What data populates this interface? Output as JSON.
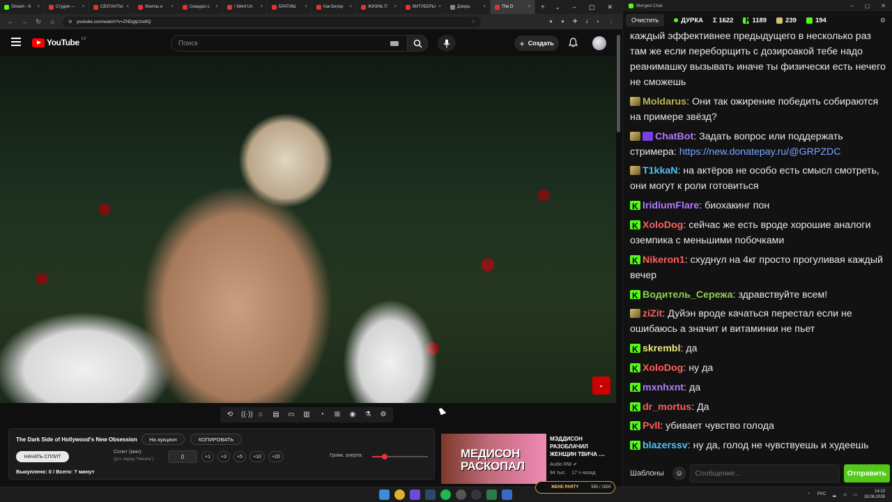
{
  "browser": {
    "tabs": [
      {
        "label": "Stream - K",
        "icon": "kick"
      },
      {
        "label": "Студия —",
        "icon": "youtube"
      },
      {
        "label": "СЕКТАНТЫ",
        "icon": "youtube"
      },
      {
        "label": "Жиллы и",
        "icon": "youtube"
      },
      {
        "label": "Скандал с",
        "icon": "youtube"
      },
      {
        "label": "I Went Un",
        "icon": "youtube"
      },
      {
        "label": "БРАТИШ",
        "icon": "youtube"
      },
      {
        "label": "Как Белор",
        "icon": "youtube"
      },
      {
        "label": "ЖИЗНЬ П",
        "icon": "youtube"
      },
      {
        "label": "ВИТУБЕРЫ",
        "icon": "youtube"
      },
      {
        "label": "Дзюра",
        "icon": "dark"
      },
      {
        "label": "The D",
        "icon": "youtube"
      }
    ],
    "url": "youtube.com/watch?v=ZNDgljz2w9Q"
  },
  "youtube": {
    "logo_text": "YouTube",
    "country_code": "LV",
    "search_placeholder": "Поиск",
    "create_label": "Создать"
  },
  "controls": {
    "icons": [
      "loop-icon",
      "broadcast-icon",
      "tag-icon",
      "clapper-icon",
      "frame-icon",
      "subtitles-icon",
      "speed-icon",
      "add-icon",
      "camera-icon",
      "flask-icon",
      "gear-icon"
    ]
  },
  "split_panel": {
    "video_title": "The Dark Side of Hollywood's New Obsession",
    "auction_label": "На аукцион",
    "copy_label": "КОПИРОВАТЬ",
    "start_label": "НАЧАТЬ СПЛИТ",
    "split_label": "Сплит (мин):",
    "split_hint": "(уст. перед \"Начать\")",
    "split_value": "0",
    "increments": [
      "+1",
      "+3",
      "+5",
      "+10",
      "+20"
    ],
    "alert_volume_label": "Громк. алерта:",
    "alert_volume_fraction": 0.22,
    "sold_text": "Выкуплено: 0 / Всего: ? минут"
  },
  "recommendation": {
    "thumb_text_line1": "МЕДИСОН",
    "thumb_text_line2": "РАСКОПАЛ",
    "title": "МЭДДИСОН РАЗОБЛАЧИЛ ЖЕНЩИН ТВИЧА ....",
    "channel": "Audio RW",
    "views": "94 тыс.",
    "age": "17 ч назад"
  },
  "chat": {
    "window_title": "Merged Chat",
    "clear_label": "Очистить",
    "streamer": "ДУРКА",
    "stats": {
      "total": "Σ 1622",
      "kick": "1189",
      "other": "239",
      "k2": "194"
    },
    "messages": [
      {
        "badge": "",
        "nick": "",
        "color": "#eaeaea",
        "text": "каждый эффективнее предыдущего в несколько раз там же если переборщить с дозироакой тебе надо реанимашку вызывать иначе ты физически есть нечего не сможешь"
      },
      {
        "badge": "sub",
        "nick": "Moldarus",
        "color": "#b9b55a",
        "text": "Они так ожирение победить собираются на примере звёзд?"
      },
      {
        "badge": "sub+bot",
        "nick": "ChatBot",
        "color": "#b37bff",
        "text": "Задать вопрос или поддержать стримера: ",
        "link": "https://new.donatepay.ru/@GRPZDC"
      },
      {
        "badge": "sub",
        "nick": "T1kkaN",
        "color": "#4fc3f7",
        "text": "на актёров не особо есть смысл смотреть, они могут к роли готовиться"
      },
      {
        "badge": "kick",
        "nick": "IridiumFlare",
        "color": "#b37bff",
        "text": "биохакинг пон"
      },
      {
        "badge": "kick",
        "nick": "XoloDog",
        "color": "#ff5f5f",
        "text": "сейчас же есть вроде хорошие аналоги оземпика с меньшими побочками"
      },
      {
        "badge": "kick",
        "nick": "Nikeron1",
        "color": "#ff5f5f",
        "text": "схуднул на 4кг просто прогуливая каждый вечер"
      },
      {
        "badge": "kick",
        "nick": "Водитель_Сережа",
        "color": "#8fd14f",
        "text": "здравствуйте всем!"
      },
      {
        "badge": "sub",
        "nick": "ziZit",
        "color": "#ff5f5f",
        "text": "Дуйэн вроде качаться перестал если не ошибаюсь а значит и витаминки не пьет"
      },
      {
        "badge": "kick",
        "nick": "skrembl",
        "color": "#e8e87a",
        "text": "да"
      },
      {
        "badge": "kick",
        "nick": "XoloDog",
        "color": "#ff5f5f",
        "text": "ну да"
      },
      {
        "badge": "kick",
        "nick": "mxnhxnt",
        "color": "#b37bff",
        "text": "да"
      },
      {
        "badge": "kick",
        "nick": "dr_mortus",
        "color": "#ff5f5f",
        "text": "Да"
      },
      {
        "badge": "kick",
        "nick": "Pvll",
        "color": "#ff5f5f",
        "text": "убивает чувство голода"
      },
      {
        "badge": "kick",
        "nick": "blazerssv",
        "color": "#4fc3f7",
        "text": "ну да, голод не чувствуешь и худеешь"
      }
    ],
    "templates_label": "Шаблоны",
    "input_placeholder": "Сообщение...",
    "send_label": "Отправить"
  },
  "taskbar": {
    "overlay_label": "ЖЕНЕ PARTY",
    "overlay_amount": "550 / 1500",
    "lang": "РУС",
    "time": "14:13",
    "date": "18.08.2026"
  }
}
